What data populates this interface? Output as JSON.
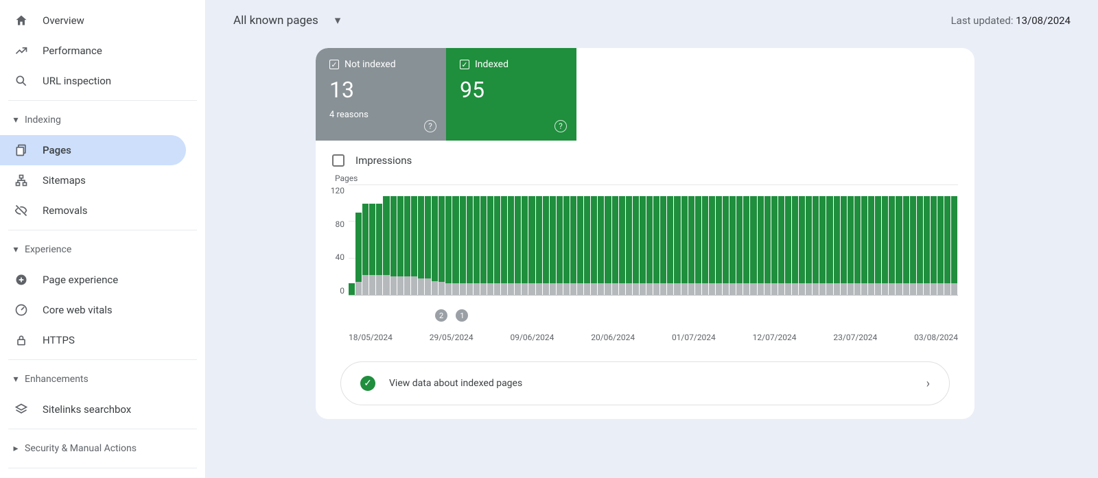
{
  "sidebar": {
    "items": [
      {
        "label": "Overview"
      },
      {
        "label": "Performance"
      },
      {
        "label": "URL inspection"
      }
    ],
    "sections": [
      {
        "label": "Indexing",
        "items": [
          {
            "label": "Pages"
          },
          {
            "label": "Sitemaps"
          },
          {
            "label": "Removals"
          }
        ]
      },
      {
        "label": "Experience",
        "items": [
          {
            "label": "Page experience"
          },
          {
            "label": "Core web vitals"
          },
          {
            "label": "HTTPS"
          }
        ]
      },
      {
        "label": "Enhancements",
        "items": [
          {
            "label": "Sitelinks searchbox"
          }
        ]
      },
      {
        "label": "Security & Manual Actions",
        "items": []
      }
    ]
  },
  "topbar": {
    "filter_label": "All known pages",
    "last_updated_label": "Last updated: ",
    "last_updated_date": "13/08/2024"
  },
  "tiles": {
    "not_indexed": {
      "label": "Not indexed",
      "count": "13",
      "sub": "4 reasons"
    },
    "indexed": {
      "label": "Indexed",
      "count": "95"
    }
  },
  "impressions_label": "Impressions",
  "action_row_label": "View data about indexed pages",
  "chart_data": {
    "type": "bar",
    "title": "Pages",
    "ylim": [
      0,
      120
    ],
    "yticks": [
      120,
      80,
      40,
      0
    ],
    "xticks": [
      "18/05/2024",
      "29/05/2024",
      "09/06/2024",
      "20/06/2024",
      "01/07/2024",
      "12/07/2024",
      "23/07/2024",
      "03/08/2024"
    ],
    "markers": [
      {
        "label": "2",
        "index": 12
      },
      {
        "label": "1",
        "index": 15
      }
    ],
    "series": [
      {
        "name": "Indexed",
        "color": "#1f8e3d"
      },
      {
        "name": "Not indexed",
        "color": "#b5b9bc"
      }
    ],
    "data": [
      {
        "green": 13,
        "grey": 0
      },
      {
        "green": 90,
        "grey": 14
      },
      {
        "green": 100,
        "grey": 22
      },
      {
        "green": 100,
        "grey": 22
      },
      {
        "green": 100,
        "grey": 22
      },
      {
        "green": 108,
        "grey": 22
      },
      {
        "green": 108,
        "grey": 20
      },
      {
        "green": 108,
        "grey": 20
      },
      {
        "green": 108,
        "grey": 20
      },
      {
        "green": 108,
        "grey": 20
      },
      {
        "green": 108,
        "grey": 18
      },
      {
        "green": 108,
        "grey": 18
      },
      {
        "green": 108,
        "grey": 15
      },
      {
        "green": 108,
        "grey": 14
      },
      {
        "green": 108,
        "grey": 13
      },
      {
        "green": 108,
        "grey": 13
      },
      {
        "green": 108,
        "grey": 13
      },
      {
        "green": 108,
        "grey": 13
      },
      {
        "green": 108,
        "grey": 13
      },
      {
        "green": 108,
        "grey": 13
      },
      {
        "green": 108,
        "grey": 13
      },
      {
        "green": 108,
        "grey": 13
      },
      {
        "green": 108,
        "grey": 13
      },
      {
        "green": 108,
        "grey": 13
      },
      {
        "green": 108,
        "grey": 13
      },
      {
        "green": 108,
        "grey": 13
      },
      {
        "green": 108,
        "grey": 13
      },
      {
        "green": 108,
        "grey": 13
      },
      {
        "green": 108,
        "grey": 13
      },
      {
        "green": 108,
        "grey": 13
      },
      {
        "green": 108,
        "grey": 13
      },
      {
        "green": 108,
        "grey": 13
      },
      {
        "green": 108,
        "grey": 13
      },
      {
        "green": 108,
        "grey": 13
      },
      {
        "green": 108,
        "grey": 13
      },
      {
        "green": 108,
        "grey": 13
      },
      {
        "green": 108,
        "grey": 13
      },
      {
        "green": 108,
        "grey": 13
      },
      {
        "green": 108,
        "grey": 13
      },
      {
        "green": 108,
        "grey": 13
      },
      {
        "green": 108,
        "grey": 13
      },
      {
        "green": 108,
        "grey": 13
      },
      {
        "green": 108,
        "grey": 13
      },
      {
        "green": 108,
        "grey": 13
      },
      {
        "green": 108,
        "grey": 13
      },
      {
        "green": 108,
        "grey": 13
      },
      {
        "green": 108,
        "grey": 13
      },
      {
        "green": 108,
        "grey": 13
      },
      {
        "green": 108,
        "grey": 13
      },
      {
        "green": 108,
        "grey": 13
      },
      {
        "green": 108,
        "grey": 13
      },
      {
        "green": 108,
        "grey": 13
      },
      {
        "green": 108,
        "grey": 13
      },
      {
        "green": 108,
        "grey": 13
      },
      {
        "green": 108,
        "grey": 13
      },
      {
        "green": 108,
        "grey": 13
      },
      {
        "green": 108,
        "grey": 13
      },
      {
        "green": 108,
        "grey": 13
      },
      {
        "green": 108,
        "grey": 13
      },
      {
        "green": 108,
        "grey": 13
      },
      {
        "green": 108,
        "grey": 13
      },
      {
        "green": 108,
        "grey": 13
      },
      {
        "green": 108,
        "grey": 13
      },
      {
        "green": 108,
        "grey": 13
      },
      {
        "green": 108,
        "grey": 13
      },
      {
        "green": 108,
        "grey": 13
      },
      {
        "green": 108,
        "grey": 13
      },
      {
        "green": 108,
        "grey": 13
      },
      {
        "green": 108,
        "grey": 13
      },
      {
        "green": 108,
        "grey": 13
      },
      {
        "green": 108,
        "grey": 13
      },
      {
        "green": 108,
        "grey": 13
      },
      {
        "green": 108,
        "grey": 13
      },
      {
        "green": 108,
        "grey": 13
      },
      {
        "green": 108,
        "grey": 13
      },
      {
        "green": 108,
        "grey": 13
      },
      {
        "green": 108,
        "grey": 13
      },
      {
        "green": 108,
        "grey": 13
      },
      {
        "green": 108,
        "grey": 13
      },
      {
        "green": 108,
        "grey": 13
      },
      {
        "green": 108,
        "grey": 13
      },
      {
        "green": 108,
        "grey": 13
      },
      {
        "green": 108,
        "grey": 13
      },
      {
        "green": 108,
        "grey": 13
      },
      {
        "green": 108,
        "grey": 13
      },
      {
        "green": 108,
        "grey": 13
      },
      {
        "green": 108,
        "grey": 13
      },
      {
        "green": 108,
        "grey": 13
      }
    ]
  }
}
